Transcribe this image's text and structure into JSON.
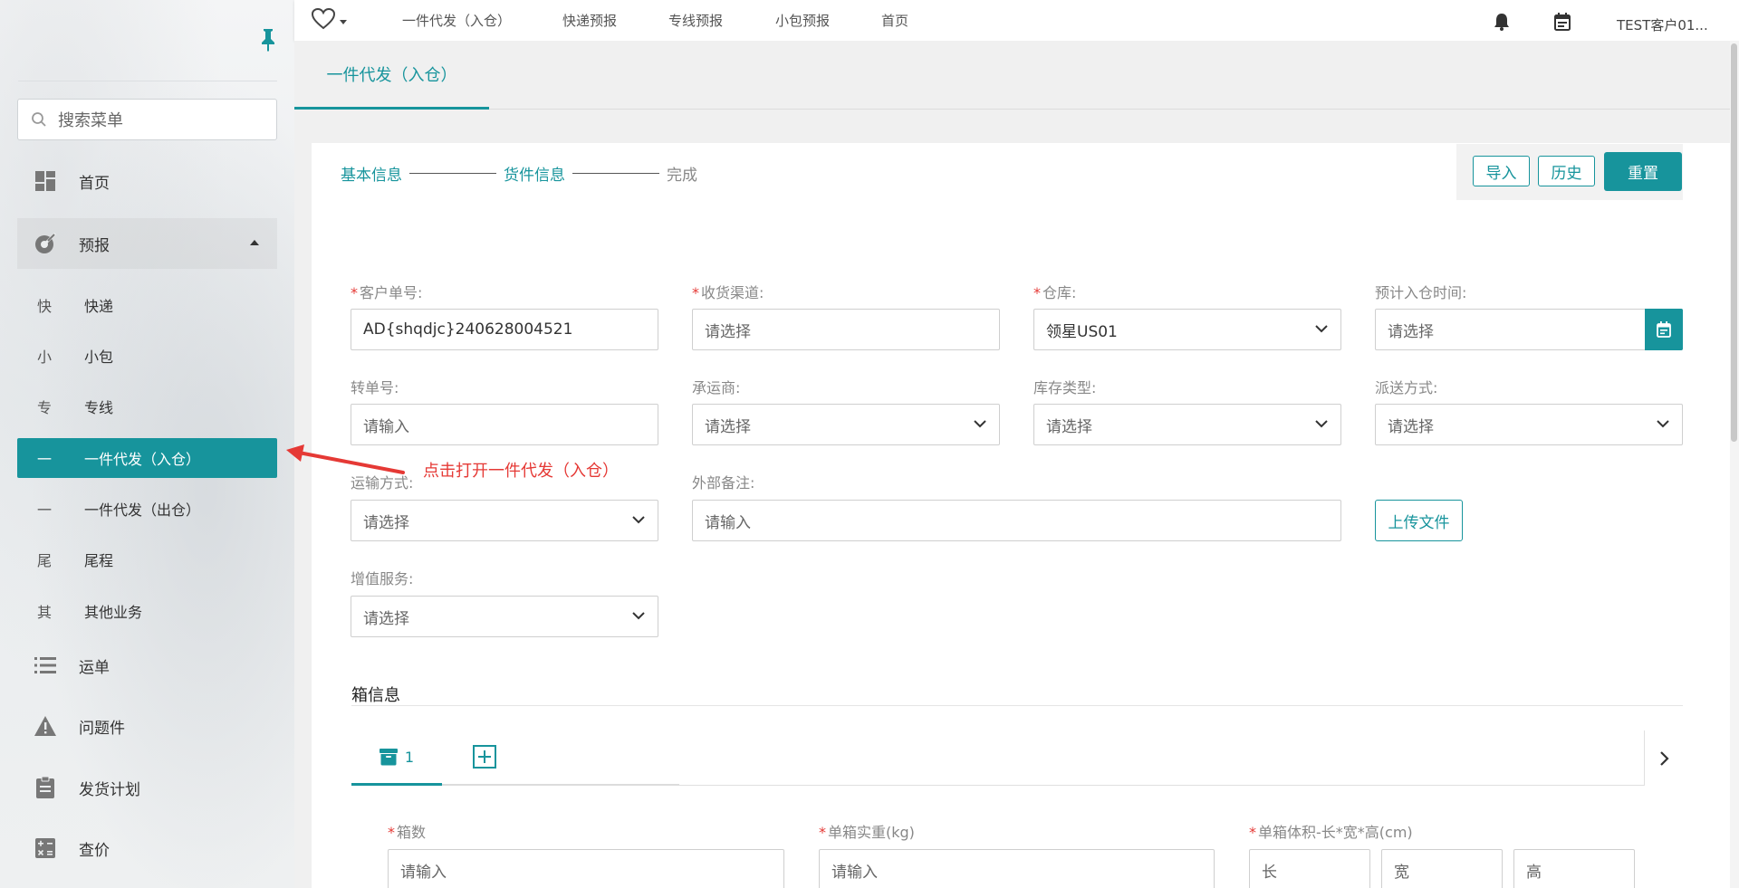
{
  "sidebar": {
    "search_placeholder": "搜索菜单",
    "items": [
      {
        "label": "首页",
        "icon": "dashboard-icon"
      },
      {
        "label": "预报",
        "icon": "forecast-icon"
      },
      {
        "char": "快",
        "label": "快递"
      },
      {
        "char": "小",
        "label": "小包"
      },
      {
        "char": "专",
        "label": "专线"
      },
      {
        "char": "一",
        "label": "一件代发（入仓）"
      },
      {
        "char": "一",
        "label": "一件代发（出仓）"
      },
      {
        "char": "尾",
        "label": "尾程"
      },
      {
        "char": "其",
        "label": "其他业务"
      },
      {
        "label": "运单",
        "icon": "list-icon"
      },
      {
        "label": "问题件",
        "icon": "warning-icon"
      },
      {
        "label": "发货计划",
        "icon": "clipboard-icon"
      },
      {
        "label": "查价",
        "icon": "calculator-icon"
      }
    ]
  },
  "topbar": {
    "nav": [
      "一件代发（入仓）",
      "快递预报",
      "专线预报",
      "小包预报",
      "首页"
    ],
    "user": "TEST客户01..."
  },
  "tab": {
    "active": "一件代发（入仓）"
  },
  "steps": [
    "基本信息",
    "货件信息",
    "完成"
  ],
  "actions": {
    "import": "导入",
    "history": "历史",
    "reset": "重置"
  },
  "form": {
    "customer_no": {
      "label": "客户单号:",
      "value": "AD{shqdjc}240628004521"
    },
    "channel": {
      "label": "收货渠道:",
      "placeholder": "请选择"
    },
    "warehouse": {
      "label": "仓库:",
      "value": "领星US01"
    },
    "eta": {
      "label": "预计入仓时间:",
      "placeholder": "请选择"
    },
    "transfer_no": {
      "label": "转单号:",
      "placeholder": "请输入"
    },
    "carrier": {
      "label": "承运商:",
      "placeholder": "请选择"
    },
    "stock_type": {
      "label": "库存类型:",
      "placeholder": "请选择"
    },
    "delivery": {
      "label": "派送方式:",
      "placeholder": "请选择"
    },
    "transport": {
      "label": "运输方式:",
      "placeholder": "请选择"
    },
    "remark": {
      "label": "外部备注:",
      "placeholder": "请输入"
    },
    "upload": "上传文件",
    "vas": {
      "label": "增值服务:",
      "placeholder": "请选择"
    }
  },
  "annotation": "点击打开一件代发（入仓）",
  "box": {
    "title": "箱信息",
    "tab_label": "1",
    "count": {
      "label": "箱数",
      "placeholder": "请输入"
    },
    "weight": {
      "label": "单箱实重(kg)",
      "placeholder": "请输入"
    },
    "volume": {
      "label": "单箱体积-长*宽*高(cm)",
      "l": "长",
      "w": "宽",
      "h": "高"
    }
  },
  "colors": {
    "accent": "#17949c",
    "required": "#e53935"
  }
}
